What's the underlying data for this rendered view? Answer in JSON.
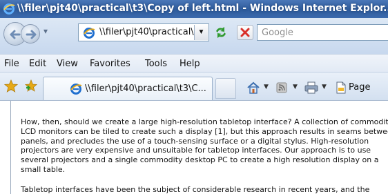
{
  "window": {
    "title": "\\\\filer\\pjt40\\practical\\t3\\Copy of left.html - Windows Internet Explor..."
  },
  "toolbar": {
    "address_text": "\\\\filer\\pjt40\\practical\\",
    "search_placeholder": "Google"
  },
  "menu": {
    "items": [
      "File",
      "Edit",
      "View",
      "Favorites",
      "Tools",
      "Help"
    ]
  },
  "favorites_bar": {
    "tab_title": "\\\\filer\\pjt40\\practical\\t3\\C...",
    "page_label": "Page"
  },
  "document": {
    "paragraph1_lines": [
      "How, then, should we create a large high-resolution tabletop interface? A collection of commodity",
      "LCD monitors can be tiled to create such a display [1], but this approach results in seams betwee",
      "panels, and precludes the use of a touch-sensing surface or a digital stylus.  High-resolution",
      "projectors are very expensive and unsuitable for tabletop interfaces. Our approach is to use",
      "several projectors and a single commodity desktop PC to create a high resolution display on a",
      "small table."
    ],
    "paragraph2_partial": "Tabletop interfaces have been the subject of considerable research in recent years, and the"
  },
  "colors": {
    "titlebar": "#3a69ad",
    "chrome": "#d3e0f0",
    "stop_red": "#d9302a",
    "refresh_green": "#2f9a2f",
    "ie_blue": "#1f6fd0",
    "star_gold": "#e6a917"
  },
  "icons": [
    "ie-logo-icon",
    "back-arrow-icon",
    "forward-arrow-icon",
    "refresh-icon",
    "stop-icon",
    "favorites-star-icon",
    "add-favorites-icon",
    "home-icon",
    "feeds-icon",
    "print-icon",
    "page-icon"
  ]
}
